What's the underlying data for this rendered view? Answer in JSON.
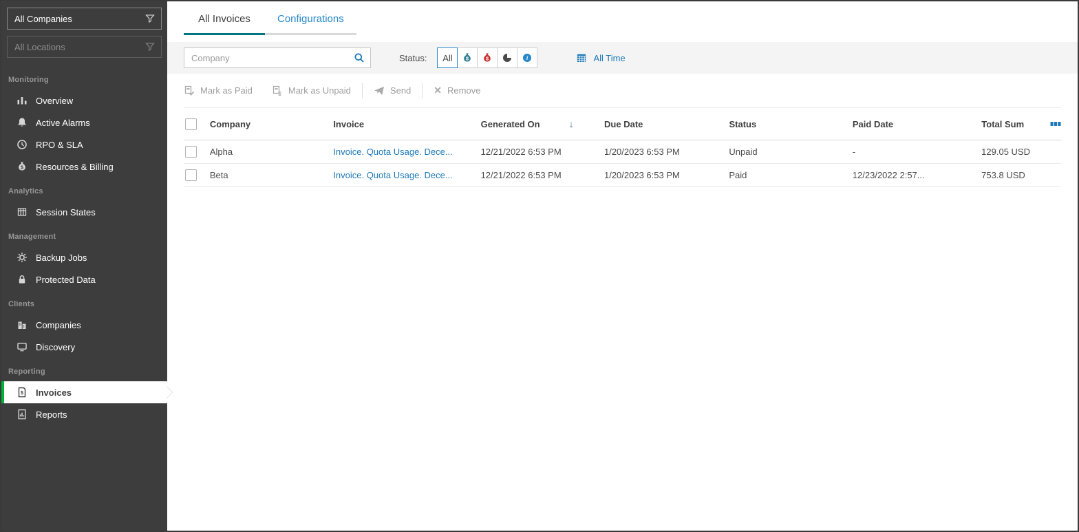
{
  "sidebar": {
    "companies_dropdown": "All Companies",
    "locations_dropdown": "All Locations",
    "sections": {
      "monitoring": "Monitoring",
      "analytics": "Analytics",
      "management": "Management",
      "clients": "Clients",
      "reporting": "Reporting"
    },
    "items": {
      "overview": "Overview",
      "active_alarms": "Active Alarms",
      "rpo_sla": "RPO & SLA",
      "resources_billing": "Resources & Billing",
      "session_states": "Session States",
      "backup_jobs": "Backup Jobs",
      "protected_data": "Protected Data",
      "companies": "Companies",
      "discovery": "Discovery",
      "invoices": "Invoices",
      "reports": "Reports"
    }
  },
  "tabs": {
    "all_invoices": "All Invoices",
    "configurations": "Configurations"
  },
  "filters": {
    "search_placeholder": "Company",
    "status_label": "Status:",
    "status_all": "All",
    "time_range": "All Time"
  },
  "toolbar": {
    "mark_paid": "Mark as Paid",
    "mark_unpaid": "Mark as Unpaid",
    "send": "Send",
    "remove": "Remove"
  },
  "table": {
    "headers": {
      "company": "Company",
      "invoice": "Invoice",
      "generated_on": "Generated On",
      "due_date": "Due Date",
      "status": "Status",
      "paid_date": "Paid Date",
      "total_sum": "Total Sum"
    },
    "rows": [
      {
        "company": "Alpha",
        "invoice": "Invoice. Quota Usage. Dece...",
        "generated_on": "12/21/2022 6:53 PM",
        "due_date": "1/20/2023 6:53 PM",
        "status": "Unpaid",
        "paid_date": "-",
        "total_sum": "129.05 USD"
      },
      {
        "company": "Beta",
        "invoice": "Invoice. Quota Usage. Dece...",
        "generated_on": "12/21/2022 6:53 PM",
        "due_date": "1/20/2023 6:53 PM",
        "status": "Paid",
        "paid_date": "12/23/2022 2:57...",
        "total_sum": "753.8 USD"
      }
    ]
  },
  "icons": {
    "sort_descending": "↓",
    "remove_glyph": "✕",
    "currency": "$",
    "info_glyph": "i"
  },
  "colors": {
    "sidebar_bg": "#3d3d3d",
    "accent_green": "#00b336",
    "tab_teal": "#00747f",
    "link_blue": "#1d7ab8",
    "paid_teal": "#2e7f93",
    "unpaid_red": "#c9302c",
    "filter_strip": "#f4f4f4"
  }
}
